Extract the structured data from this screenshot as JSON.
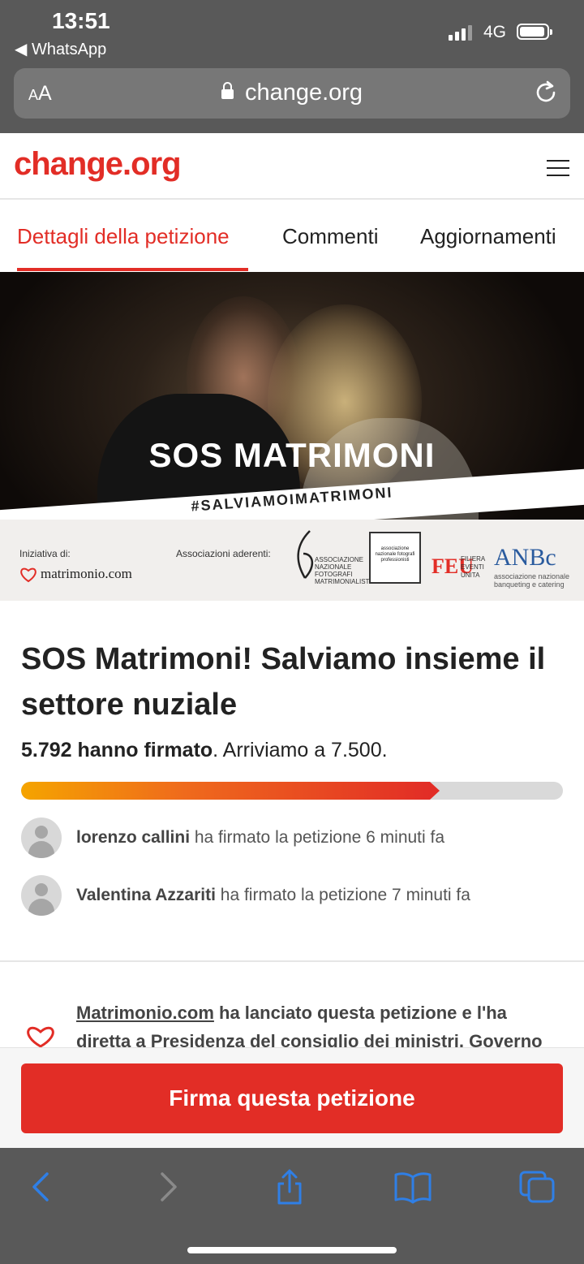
{
  "status_bar": {
    "time": "13:51",
    "back_app": "WhatsApp",
    "network": "4G"
  },
  "browser": {
    "text_size_label_small": "A",
    "text_size_label_large": "A",
    "url": "change.org"
  },
  "site": {
    "logo": "change.org"
  },
  "tabs": [
    {
      "label": "Dettagli della petizione",
      "active": true
    },
    {
      "label": "Commenti",
      "active": false
    },
    {
      "label": "Aggiornamenti",
      "active": false
    }
  ],
  "hero": {
    "title": "SOS MATRIMONI",
    "hashtag": "#SALVIAMOIMATRIMONI",
    "initiative_label": "Iniziativa di:",
    "initiative_brand": "matrimonio.com",
    "associations_label": "Associazioni aderenti:",
    "assoc_1": "ASSOCIAZIONE NAZIONALE FOTOGRAFI MATRIMONIALISTI",
    "assoc_2": "associazione nazionale fotografi professionisti",
    "assoc_3": "FEU",
    "assoc_3_sub": "FILIERA EVENTI UNITA",
    "assoc_4": "ANBc",
    "assoc_4_sub": "associazione nazionale banqueting e catering"
  },
  "petition": {
    "title": "SOS Matrimoni! Salviamo insieme il settore nuziale",
    "signed_count": "5.792 hanno firmato",
    "goal_text": ". Arriviamo a 7.500.",
    "progress_fraction": 0.7723,
    "signers": [
      {
        "name": "lorenzo callini",
        "action": " ha firmato la petizione 6 minuti fa"
      },
      {
        "name": "Valentina Azzariti",
        "action": " ha firmato la petizione 7 minuti fa"
      }
    ],
    "starter_link": "Matrimonio.com",
    "starter_text": " ha lanciato questa petizione e l'ha diretta a Presidenza del consiglio dei ministri, Governo"
  },
  "cta": {
    "label": "Firma questa petizione"
  },
  "colors": {
    "brand_red": "#e22d26",
    "browser_chrome": "#595959",
    "toolbar_icon": "#2f7fe6"
  }
}
